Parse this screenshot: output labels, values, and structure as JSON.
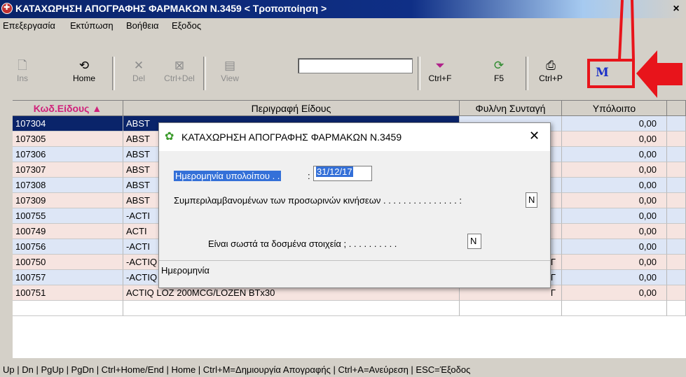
{
  "window": {
    "title": "ΚΑΤΑΧΩΡΗΣΗ ΑΠΟΓΡΑΦΗΣ ΦΑΡΜΑΚΩΝ Ν.3459 < Τροποποίηση >",
    "close": "×"
  },
  "menu": [
    "Επεξεργασία",
    "Εκτύπωση",
    "Βοήθεια",
    "Εξοδος"
  ],
  "toolbar": {
    "ins": "Ins",
    "home": "Home",
    "del": "Del",
    "ctrl_del": "Ctrl+Del",
    "view": "View",
    "ctrl_f": "Ctrl+F",
    "f5": "F5",
    "ctrl_p": "Ctrl+P",
    "m_button": "M",
    "search_value": ""
  },
  "grid": {
    "headers": {
      "code": "Κωδ.Είδους ▲",
      "desc": "Περιγραφή Είδους",
      "rx": "Φυλ/νη Συνταγή",
      "bal": "Υπόλοιπο"
    },
    "rows": [
      {
        "code": "107304",
        "desc": "ABST",
        "rx": "",
        "bal": "0,00"
      },
      {
        "code": "107305",
        "desc": "ABST",
        "rx": "",
        "bal": "0,00"
      },
      {
        "code": "107306",
        "desc": "ABST",
        "rx": "",
        "bal": "0,00"
      },
      {
        "code": "107307",
        "desc": "ABST",
        "rx": "",
        "bal": "0,00"
      },
      {
        "code": "107308",
        "desc": "ABST",
        "rx": "",
        "bal": "0,00"
      },
      {
        "code": "107309",
        "desc": "ABST",
        "rx": "",
        "bal": "0,00"
      },
      {
        "code": "100755",
        "desc": "-ACTI",
        "rx": "",
        "bal": "0,00"
      },
      {
        "code": "100749",
        "desc": "ACTI",
        "rx": "",
        "bal": "0,00"
      },
      {
        "code": "100756",
        "desc": "-ACTI",
        "rx": "",
        "bal": "0,00"
      },
      {
        "code": "100750",
        "desc": "-ACTIQ LOZ 1600MCG/LOZEN BTx30",
        "rx": "Γ",
        "bal": "0,00"
      },
      {
        "code": "100757",
        "desc": "-ACTIQ LOZ 200MCG/LOZEN BTx3",
        "rx": "Γ",
        "bal": "0,00"
      },
      {
        "code": "100751",
        "desc": "ACTIQ LOZ 200MCG/LOZEN BTx30",
        "rx": "Γ",
        "bal": "0,00"
      },
      {
        "code": "",
        "desc": "",
        "rx": "",
        "bal": ""
      }
    ]
  },
  "dialog": {
    "title": "ΚΑΤΑΧΩΡΗΣΗ ΑΠΟΓΡΑΦΗΣ ΦΑΡΜΑΚΩΝ Ν.3459",
    "close": "✕",
    "date_label": "Ημερομηνία υπολοίπου . .",
    "date_sep": ":",
    "date_value": "31/12/17",
    "temp_label": "Συμπεριλαμβανομένων των προσωρινών κινήσεων . . . . . . . . . . . . . . . :",
    "temp_value": "N",
    "confirm_label": "Είναι σωστά τα δοσμένα στοιχεία ; . . . . . . . . . .",
    "confirm_value": "N",
    "hint": "Ημερομηνία"
  },
  "status": "Up | Dn | PgUp | PgDn | Ctrl+Home/End | Home | Ctrl+M=Δημιουργία Απογραφής | Ctrl+A=Ανεύρεση | ESC=Έξοδος",
  "colors": {
    "row_blue": "#dde6f6",
    "row_pink": "#f6e4e0",
    "selected": "#0a246a",
    "annotation_red": "#e8141b",
    "m_blue": "#1c31c8"
  }
}
